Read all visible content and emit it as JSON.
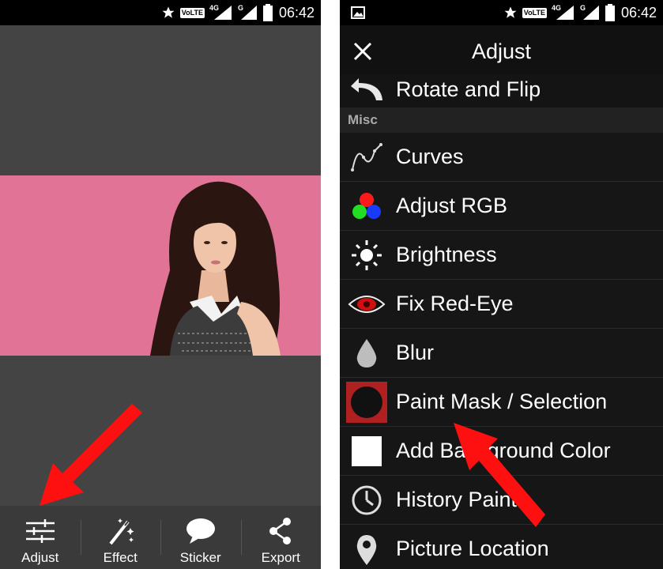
{
  "status": {
    "time": "06:42",
    "volte": "VoLTE",
    "net1": "4G",
    "net2": "G"
  },
  "editor": {
    "toolbar": [
      {
        "id": "adjust",
        "label": "Adjust",
        "icon": "sliders-icon"
      },
      {
        "id": "effect",
        "label": "Effect",
        "icon": "magic-wand-icon"
      },
      {
        "id": "sticker",
        "label": "Sticker",
        "icon": "speech-bubble-icon"
      },
      {
        "id": "export",
        "label": "Export",
        "icon": "share-icon"
      }
    ]
  },
  "adjust_menu": {
    "title": "Adjust",
    "partial_item": {
      "label": "Rotate and Flip",
      "icon": "rotate-arrow-icon"
    },
    "section": "Misc",
    "items": [
      {
        "label": "Curves",
        "icon": "curves-icon"
      },
      {
        "label": "Adjust RGB",
        "icon": "rgb-dots-icon"
      },
      {
        "label": "Brightness",
        "icon": "sun-icon"
      },
      {
        "label": "Fix Red-Eye",
        "icon": "red-eye-icon"
      },
      {
        "label": "Blur",
        "icon": "drop-icon"
      },
      {
        "label": "Paint Mask / Selection",
        "icon": "mask-circle-icon"
      },
      {
        "label": "Add Background Color",
        "icon": "white-square-icon"
      },
      {
        "label": "History Paint",
        "icon": "clock-icon"
      },
      {
        "label": "Picture Location",
        "icon": "location-pin-icon"
      }
    ]
  },
  "colors": {
    "photo_background": "#e17396",
    "annotation_arrow": "#ff1010",
    "mask_highlight": "#b02020"
  }
}
